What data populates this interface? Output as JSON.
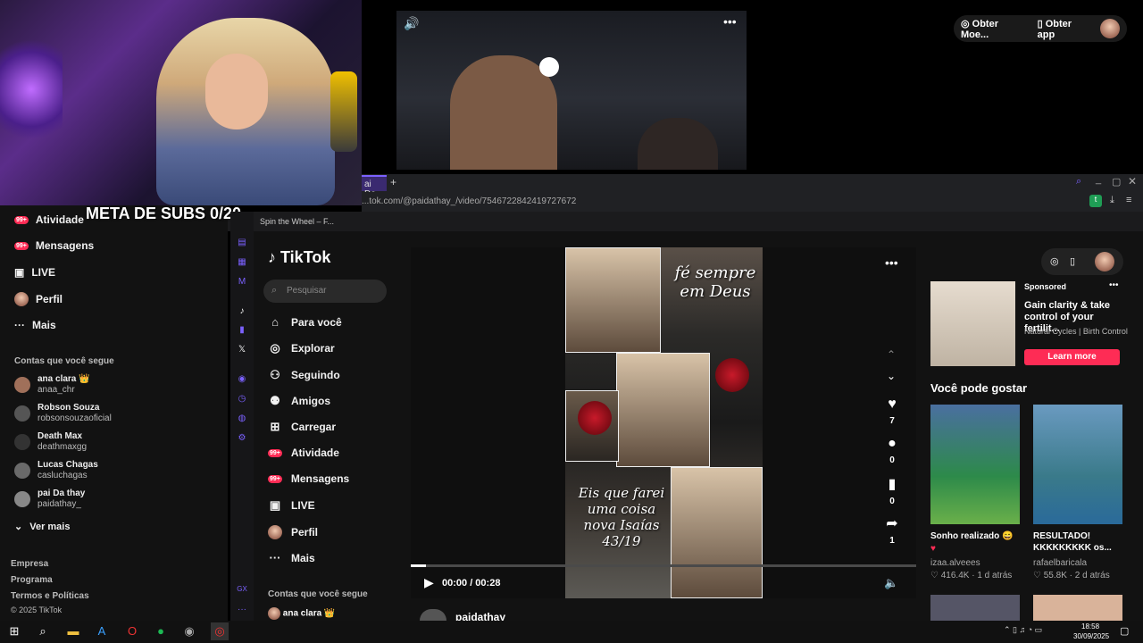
{
  "webcam": {
    "meta_text": "META DE SUBS 0/20"
  },
  "top_video": {
    "sound_icon": "speaker-icon",
    "more_icon": "more-icon"
  },
  "top_right": {
    "coins_label": "Obter Moe...",
    "app_label": "Obter app"
  },
  "browser": {
    "tab_label": "ai De",
    "url": "...tok.com/@paidathay_/video/7546722842419727672",
    "bookmark": "Spin the Wheel – F..."
  },
  "left_nav": {
    "items": [
      {
        "label": "Atividade",
        "badge": "99+"
      },
      {
        "label": "Mensagens",
        "badge": "99+"
      },
      {
        "label": "LIVE"
      },
      {
        "label": "Perfil"
      },
      {
        "label": "Mais"
      }
    ],
    "following_title": "Contas que você segue",
    "following": [
      {
        "name": "ana clara 👑",
        "handle": "anaa_chr"
      },
      {
        "name": "Robson Souza",
        "handle": "robsonsouzaoficial"
      },
      {
        "name": "Death Max",
        "handle": "deathmaxgg"
      },
      {
        "name": "Lucas Chagas",
        "handle": "casluchagas"
      },
      {
        "name": "pai Da thay",
        "handle": "paidathay_"
      }
    ],
    "see_more": "Ver mais",
    "footer": [
      "Empresa",
      "Programa",
      "Termos e Políticas",
      "© 2025 TikTok"
    ]
  },
  "tiktok": {
    "logo": "TikTok",
    "search_placeholder": "Pesquisar",
    "nav": [
      {
        "label": "Para você",
        "icon": "home-icon"
      },
      {
        "label": "Explorar",
        "icon": "compass-icon"
      },
      {
        "label": "Seguindo",
        "icon": "following-icon"
      },
      {
        "label": "Amigos",
        "icon": "friends-icon"
      },
      {
        "label": "Carregar",
        "icon": "upload-icon"
      },
      {
        "label": "Atividade",
        "icon": "activity-icon",
        "badge": "99+"
      },
      {
        "label": "Mensagens",
        "icon": "messages-icon",
        "badge": "99+"
      },
      {
        "label": "LIVE",
        "icon": "live-icon"
      },
      {
        "label": "Perfil",
        "icon": "profile-icon"
      },
      {
        "label": "Mais",
        "icon": "more-icon"
      }
    ],
    "following_title": "Contas que você segue",
    "following_first": "ana clara 👑"
  },
  "video": {
    "text_top": "fé sempre em Deus",
    "text_bottom": "Eis que farei uma coisa nova Isaías 43/19",
    "time": "00:00 / 00:28",
    "progress": 0.03,
    "author": "paidathay",
    "actions": {
      "likes": "7",
      "comments": "0",
      "saves": "0",
      "shares": "1"
    }
  },
  "sidebar": {
    "ad": {
      "sponsored": "Sponsored",
      "title": "Gain clarity & take control of your fertilit...",
      "brand": "Natural Cycles | Birth Control",
      "cta": "Learn more"
    },
    "you_may_like": "Você pode gostar",
    "cards": [
      {
        "title": "Sonho realizado 😄",
        "author": "izaa.alveees",
        "likes": "416.4K",
        "age": "1 d atrás"
      },
      {
        "title": "RESULTADO! KKKKKKKKK os...",
        "author": "rafaelbaricala",
        "likes": "55.8K",
        "age": "2 d atrás"
      }
    ]
  },
  "taskbar": {
    "time": "18:58",
    "date": "30/09/2025"
  }
}
